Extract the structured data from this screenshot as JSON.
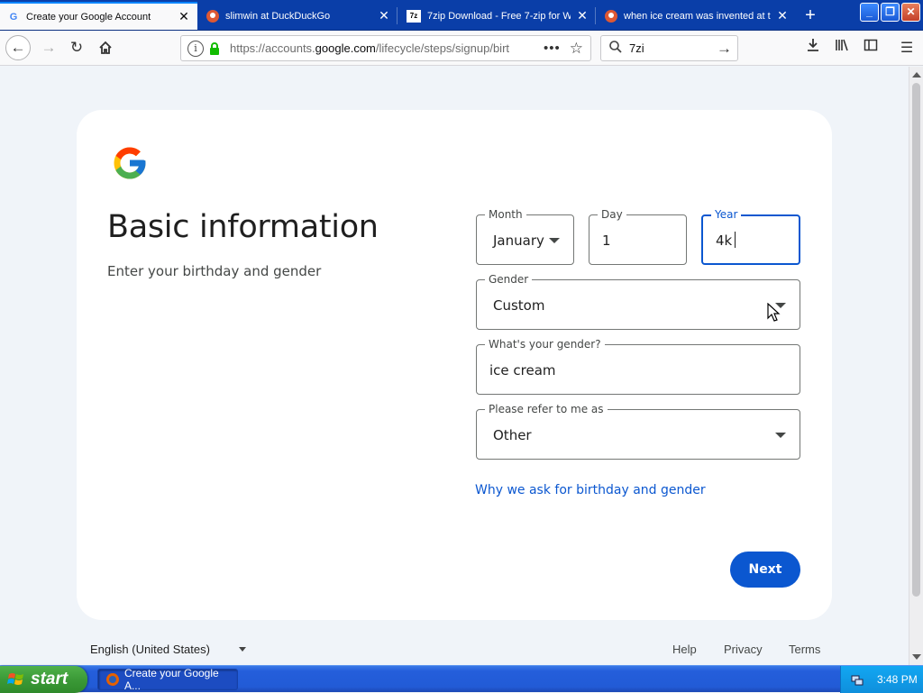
{
  "tabs": [
    {
      "title": "Create your Google Account",
      "icon": "google-g-icon",
      "active": true
    },
    {
      "title": "slimwin at DuckDuckGo",
      "icon": "duckduckgo-icon",
      "active": false
    },
    {
      "title": "7zip Download - Free 7-zip for W",
      "icon": "7zip-icon",
      "active": false
    },
    {
      "title": "when ice cream was invented at t",
      "icon": "duckduckgo-icon",
      "active": false
    }
  ],
  "navbar": {
    "url_prefix": "https://accounts.",
    "url_domain": "google.com",
    "url_suffix": "/lifecycle/steps/signup/birt",
    "search_query": "7zi"
  },
  "page": {
    "heading": "Basic information",
    "subheading": "Enter your birthday and gender",
    "month": {
      "label": "Month",
      "value": "January"
    },
    "day": {
      "label": "Day",
      "value": "1"
    },
    "year": {
      "label": "Year",
      "value": "4k"
    },
    "gender": {
      "label": "Gender",
      "value": "Custom"
    },
    "custom_gender": {
      "label": "What's your gender?",
      "value": "ice cream"
    },
    "pronoun": {
      "label": "Please refer to me as",
      "value": "Other"
    },
    "why_link": "Why we ask for birthday and gender",
    "next_button": "Next"
  },
  "footer": {
    "language": "English (United States)",
    "links": [
      "Help",
      "Privacy",
      "Terms"
    ]
  },
  "taskbar": {
    "start_label": "start",
    "window_item": "Create your Google A...",
    "clock": "3:48 PM"
  },
  "colors": {
    "google_blue": "#0b57d0",
    "xp_taskbar": "#245edb",
    "xp_start_green": "#3b9a37"
  }
}
